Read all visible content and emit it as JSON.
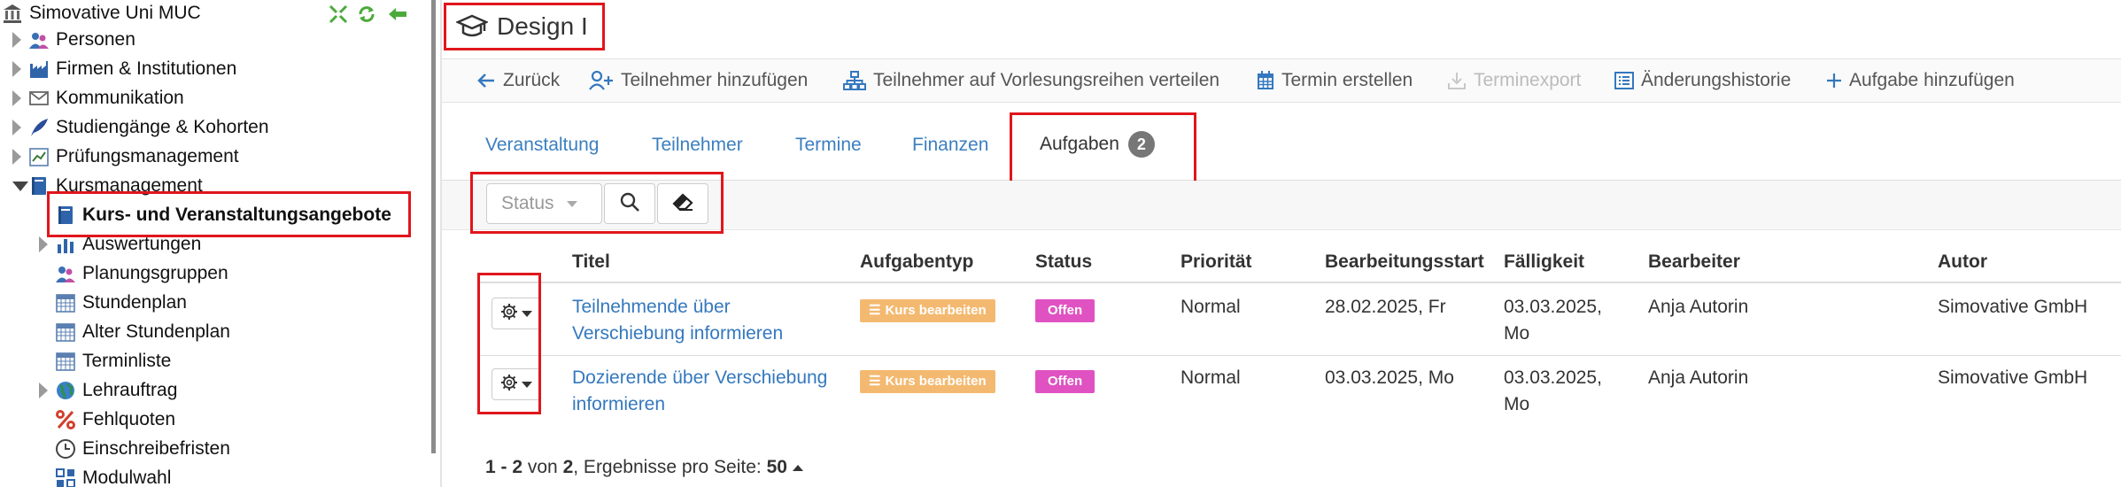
{
  "sidebar": {
    "root_label": "Simovative Uni MUC",
    "items": [
      {
        "label": "Personen",
        "icon": "people-icon"
      },
      {
        "label": "Firmen & Institutionen",
        "icon": "factory-icon"
      },
      {
        "label": "Kommunikation",
        "icon": "envelope-icon"
      },
      {
        "label": "Studiengänge & Kohorten",
        "icon": "feather-icon"
      },
      {
        "label": "Prüfungsmanagement",
        "icon": "chart-icon"
      },
      {
        "label": "Kursmanagement",
        "icon": "book-icon"
      },
      {
        "label": "Kurs- und Veranstaltungsangebote",
        "icon": "book-icon"
      },
      {
        "label": "Auswertungen",
        "icon": "bar-chart-icon"
      },
      {
        "label": "Planungsgruppen",
        "icon": "people-icon"
      },
      {
        "label": "Stundenplan",
        "icon": "calendar-icon"
      },
      {
        "label": "Alter Stundenplan",
        "icon": "calendar-icon"
      },
      {
        "label": "Terminliste",
        "icon": "calendar-icon"
      },
      {
        "label": "Lehrauftrag",
        "icon": "globe-icon"
      },
      {
        "label": "Fehlquoten",
        "icon": "percent-icon"
      },
      {
        "label": "Einschreibefristen",
        "icon": "clock-icon"
      },
      {
        "label": "Modulwahl",
        "icon": "grid-icon"
      }
    ]
  },
  "page": {
    "title": "Design I"
  },
  "toolbar": {
    "back": "Zurück",
    "add_participant": "Teilnehmer hinzufügen",
    "distribute": "Teilnehmer auf Vorlesungsreihen verteilen",
    "create_date": "Termin erstellen",
    "export": "Terminexport",
    "history": "Änderungshistorie",
    "add_task": "Aufgabe hinzufügen"
  },
  "tabs": {
    "event": "Veranstaltung",
    "participants": "Teilnehmer",
    "dates": "Termine",
    "finances": "Finanzen",
    "tasks": "Aufgaben",
    "tasks_count": "2"
  },
  "filters": {
    "status_placeholder": "Status"
  },
  "table": {
    "headers": [
      "Titel",
      "Aufgabentyp",
      "Status",
      "Priorität",
      "Bearbeitungsstart",
      "Fälligkeit",
      "Bearbeiter",
      "Autor"
    ],
    "rows": [
      {
        "title_line1": "Teilnehmende über",
        "title_line2": "Verschiebung informieren",
        "type": "Kurs bearbeiten",
        "status": "Offen",
        "priority": "Normal",
        "start": "28.02.2025, Fr",
        "due_line1": "03.03.2025,",
        "due_line2": "Mo",
        "assignee": "Anja Autorin",
        "author": "Simovative GmbH"
      },
      {
        "title_line1": "Dozierende über Verschiebung",
        "title_line2": "informieren",
        "type": "Kurs bearbeiten",
        "status": "Offen",
        "priority": "Normal",
        "start": "03.03.2025, Mo",
        "due_line1": "03.03.2025,",
        "due_line2": "Mo",
        "assignee": "Anja Autorin",
        "author": "Simovative GmbH"
      }
    ]
  },
  "pager": {
    "range": "1 - 2",
    "of_label": "von",
    "total": "2",
    "per_page_label": ", Ergebnisse pro Seite:",
    "per_page": "50"
  },
  "colors": {
    "highlight": "#e0161c",
    "link": "#3478be",
    "type_badge": "#f4b970",
    "status_badge": "#e052c2"
  }
}
